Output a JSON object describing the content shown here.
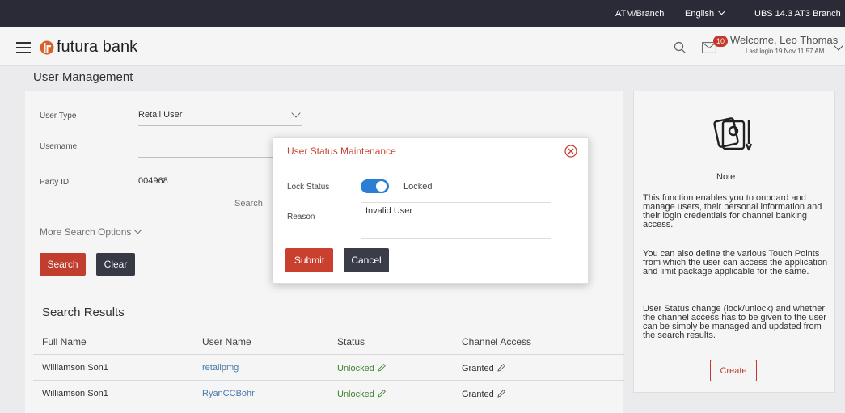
{
  "topbar": {
    "atm_branch": "ATM/Branch",
    "language": "English",
    "branch": "UBS 14.3 AT3 Branch"
  },
  "header": {
    "brand": "futura bank",
    "notification_count": "10",
    "welcome": "Welcome, Leo Thomas",
    "last_login": "Last login 19 Nov 11:57 AM"
  },
  "page": {
    "title": "User Management"
  },
  "search_form": {
    "user_type_label": "User Type",
    "user_type_value": "Retail User",
    "username_label": "Username",
    "username_value": "",
    "party_id_label": "Party ID",
    "party_id_value": "004968",
    "search_link": "Search",
    "more_options": "More Search Options",
    "search_button": "Search",
    "clear_button": "Clear"
  },
  "results": {
    "title": "Search Results",
    "columns": [
      "Full Name",
      "User Name",
      "Status",
      "Channel Access"
    ],
    "rows": [
      {
        "full_name": "Williamson Son1",
        "user_name": "retailpmg",
        "status": "Unlocked",
        "channel_access": "Granted"
      },
      {
        "full_name": "Williamson Son1",
        "user_name": "RyanCCBohr",
        "status": "Unlocked",
        "channel_access": "Granted"
      }
    ]
  },
  "note": {
    "title": "Note",
    "p1": "This function enables you to onboard and manage users, their personal information and their login credentials for channel banking access.",
    "p2": "You can also define the various Touch Points from which the user can access the application and limit package applicable for the same.",
    "p3": "User Status change (lock/unlock) and whether the channel access has to be given to the user can be simply be managed and updated from the search results.",
    "create_button": "Create"
  },
  "modal": {
    "title": "User Status Maintenance",
    "lock_status_label": "Lock Status",
    "lock_status_value": "Locked",
    "lock_status_on": true,
    "reason_label": "Reason",
    "reason_value": "Invalid User",
    "submit_button": "Submit",
    "cancel_button": "Cancel"
  },
  "colors": {
    "accent_red": "#c9402f",
    "toggle_blue": "#2a7fd4",
    "status_green": "#3d8b2e",
    "link_blue": "#4b7fb0",
    "topbar_bg": "#2b2b38"
  }
}
